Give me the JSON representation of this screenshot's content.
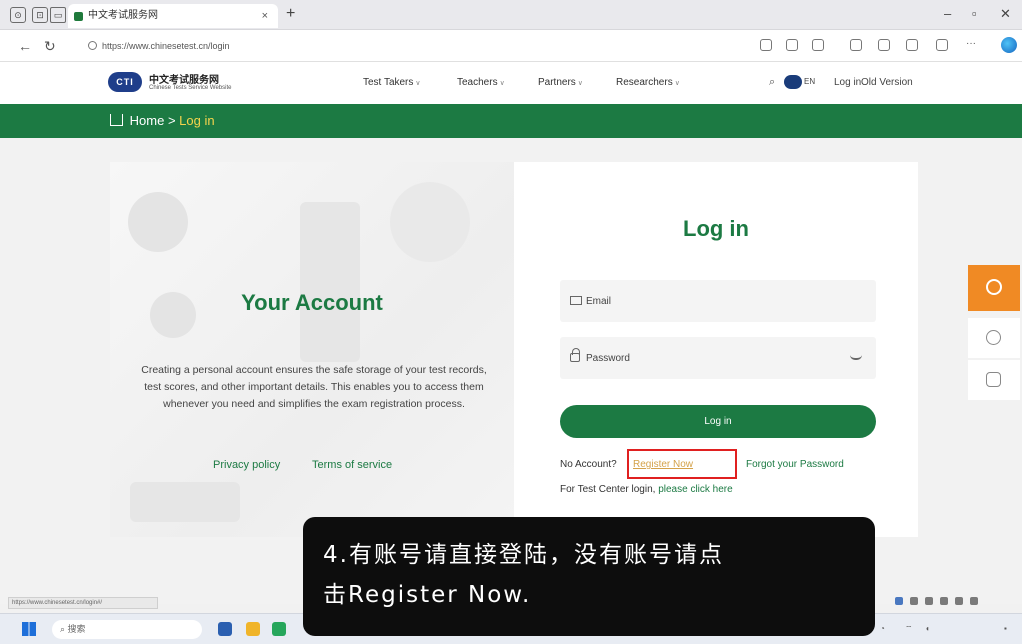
{
  "browser": {
    "tab_title": "中文考试服务网",
    "tab_close": "×",
    "new_tab": "+",
    "url": "https://www.chinesetest.cn/login",
    "window_controls": {
      "minimize": "–",
      "maximize": "▫",
      "close": "✕"
    }
  },
  "site": {
    "logo_mark": "CTI",
    "logo_cn": "中文考试服务网",
    "logo_en": "Chinese Tests Service Website",
    "nav": [
      {
        "label": "Test Takers"
      },
      {
        "label": "Teachers"
      },
      {
        "label": "Partners"
      },
      {
        "label": "Researchers"
      }
    ],
    "lang": "EN",
    "login_link": "Log in",
    "old_version": "Old Version"
  },
  "breadcrumb": {
    "home": "Home",
    "sep": ">",
    "current": "Log in"
  },
  "left_panel": {
    "title": "Your Account",
    "description": "Creating a personal account ensures the safe storage of your test records, test scores, and other important details. This enables you to access them whenever you need and simplifies the exam registration process.",
    "privacy": "Privacy policy",
    "terms": "Terms of service"
  },
  "login_form": {
    "title": "Log in",
    "email_placeholder": "Email",
    "password_placeholder": "Password",
    "submit": "Log in",
    "no_account": "No Account?",
    "register": "Register Now",
    "forgot": "Forgot your Password",
    "test_center_prefix": "For Test Center login, ",
    "test_center_link": "please click here"
  },
  "status_url": "https://www.chinesetest.cn/login#/",
  "taskbar": {
    "search": "搜索"
  },
  "caption": {
    "line1": "4.有账号请直接登陆，没有账号请点",
    "line2": "击Register  Now."
  },
  "colors": {
    "brand_green": "#1c7a43",
    "accent_orange": "#f08a24",
    "highlight_red": "#e02020"
  }
}
